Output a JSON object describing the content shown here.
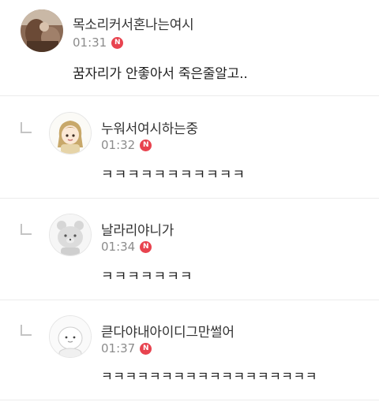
{
  "comments": [
    {
      "nickname": "목소리커서혼나는여시",
      "time": "01:31",
      "badge": "N",
      "text": "꿈자리가 안좋아서 죽은줄알고..",
      "avatar_icon": "photo-avatar-icon"
    },
    {
      "nickname": "누워서여시하는중",
      "time": "01:32",
      "badge": "N",
      "text": "ㅋㅋㅋㅋㅋㅋㅋㅋㅋㅋㅋ",
      "avatar_icon": "girl-avatar-icon"
    },
    {
      "nickname": "날라리야니가",
      "time": "01:34",
      "badge": "N",
      "text": "ㅋㅋㅋㅋㅋㅋㅋ",
      "avatar_icon": "bear-avatar-icon"
    },
    {
      "nickname": "큳다야내아이디그만썰어",
      "time": "01:37",
      "badge": "N",
      "text": "ㅋㅋㅋㅋㅋㅋㅋㅋㅋㅋㅋㅋㅋㅋㅋㅋㅋㅋ",
      "avatar_icon": "blob-avatar-icon"
    }
  ],
  "colors": {
    "badge": "#e8434f",
    "divider": "#ececec",
    "meta": "#8c8c8c"
  }
}
